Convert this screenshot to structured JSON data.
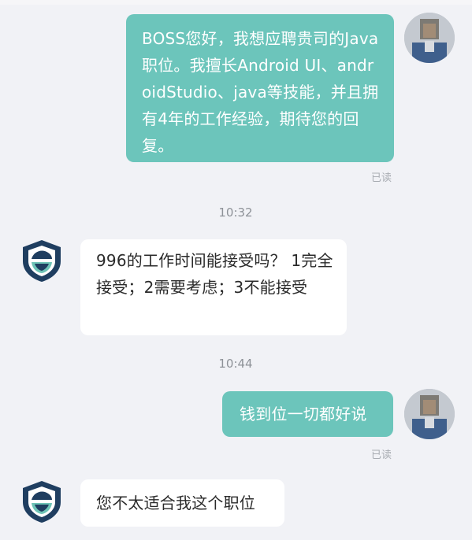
{
  "conversation": {
    "messages": [
      {
        "sender": "me",
        "text": "BOSS您好，我想应聘贵司的Java职位。我擅长Android UI、androidStudio、java等技能，并且拥有4年的工作经验，期待您的回复。",
        "status": "已读"
      },
      {
        "type": "timestamp",
        "text": "10:32"
      },
      {
        "sender": "boss",
        "text": "996的工作时间能接受吗？ 1完全接受；2需要考虑；3不能接受"
      },
      {
        "type": "timestamp",
        "text": "10:44"
      },
      {
        "sender": "me",
        "text": "钱到位一切都好说",
        "status": "已读"
      },
      {
        "sender": "boss",
        "text": "您不太适合我这个职位"
      }
    ]
  },
  "colors": {
    "background": "#f1f2f6",
    "outgoing_bubble": "#6cc5bb",
    "incoming_bubble": "#ffffff",
    "boss_logo_dark": "#1f3e60",
    "boss_logo_light": "#6dc3b6"
  },
  "icons": {
    "user_avatar": "pixelated-avatar-icon",
    "boss_avatar": "shield-logo-icon"
  }
}
